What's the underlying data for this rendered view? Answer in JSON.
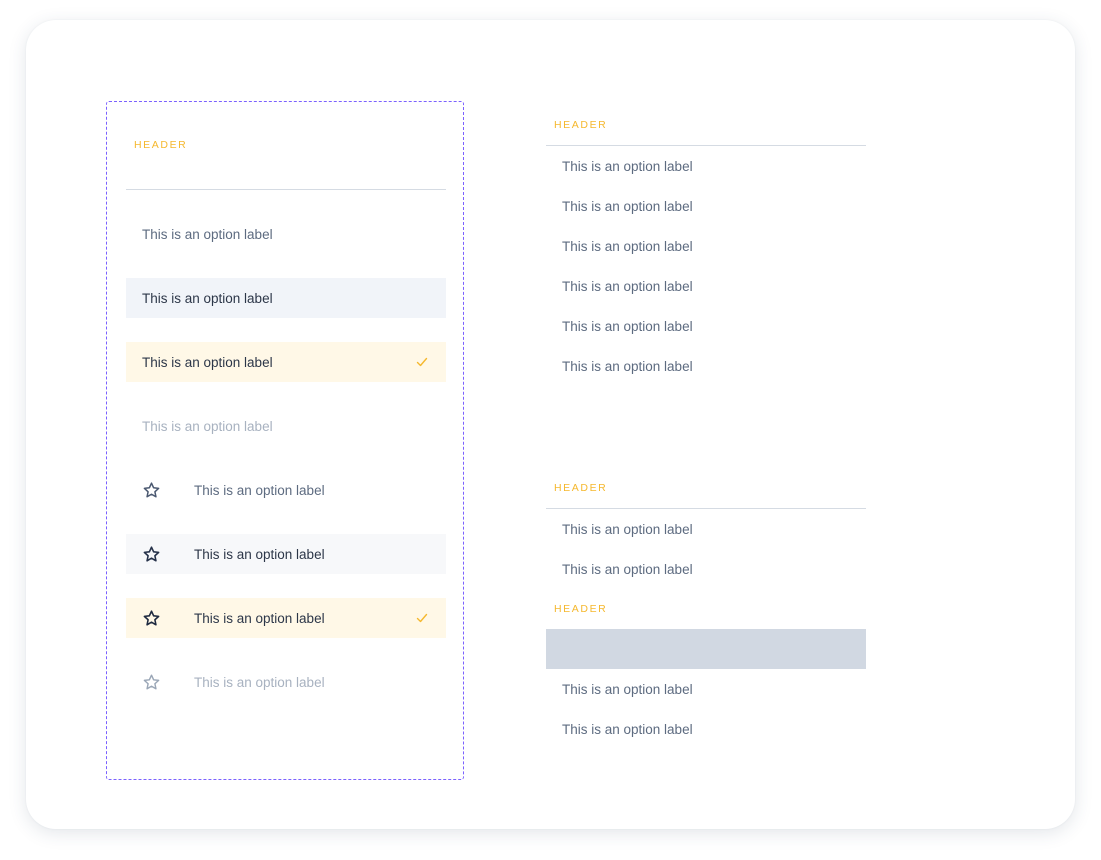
{
  "colors": {
    "accent_header": "#f5b82e",
    "frame_dashed": "#7b61ff",
    "selected_bg": "#fff8e7",
    "hover_bg": "#f1f4f9",
    "check": "#f5b82e",
    "blank_row_bg": "#d1d8e2"
  },
  "left_panel": {
    "header": "HEADER",
    "options": [
      {
        "label": "This is an option label",
        "state": "default"
      },
      {
        "label": "This is an option label",
        "state": "hover"
      },
      {
        "label": "This is an option label",
        "state": "selected",
        "icon_right": "check-icon"
      },
      {
        "label": "This is an option label",
        "state": "disabled"
      },
      {
        "label": "This is an option label",
        "state": "default",
        "icon_left": "star-icon"
      },
      {
        "label": "This is an option label",
        "state": "hover",
        "icon_left": "star-icon"
      },
      {
        "label": "This is an option label",
        "state": "selected",
        "icon_left": "star-icon",
        "icon_right": "check-icon"
      },
      {
        "label": "This is an option label",
        "state": "disabled",
        "icon_left": "star-icon"
      }
    ]
  },
  "right_top_group": {
    "header": "HEADER",
    "options": [
      {
        "label": "This is an option label"
      },
      {
        "label": "This is an option label"
      },
      {
        "label": "This is an option label"
      },
      {
        "label": "This is an option label"
      },
      {
        "label": "This is an option label"
      },
      {
        "label": "This is an option label"
      }
    ]
  },
  "right_bottom_group": {
    "header_1": "HEADER",
    "options_1": [
      {
        "label": "This is an option label"
      },
      {
        "label": "This is an option label"
      }
    ],
    "header_2": "HEADER",
    "options_2": [
      {
        "label": "This is an option label"
      },
      {
        "label": "This is an option label"
      }
    ]
  }
}
